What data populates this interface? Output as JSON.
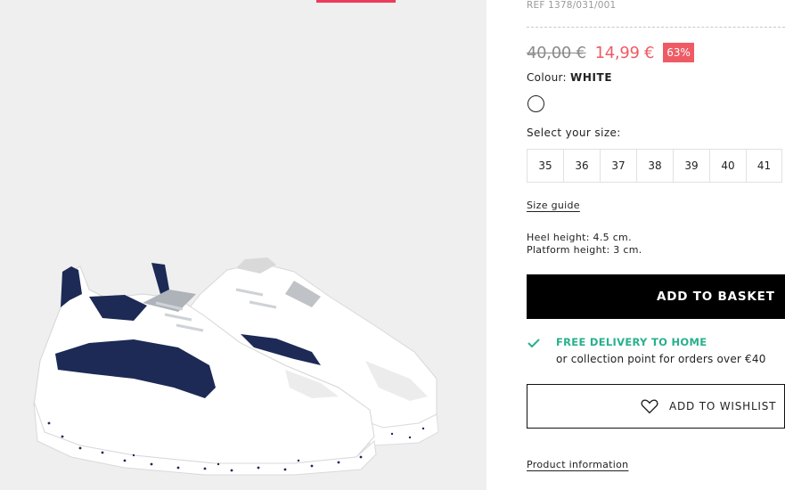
{
  "product": {
    "ref": "REF 1378/031/001",
    "old_price": "40,00 €",
    "new_price": "14,99 €",
    "discount": "63%",
    "colour_label": "Colour:",
    "colour_value": "WHITE",
    "size_label": "Select your size:",
    "sizes": [
      "35",
      "36",
      "37",
      "38",
      "39",
      "40",
      "41"
    ],
    "size_guide_label": "Size guide",
    "heel_height": "Heel height: 4.5 cm.",
    "platform_height": "Platform height: 3 cm.",
    "add_to_basket_label": "ADD TO BASKET",
    "delivery_title": "FREE DELIVERY TO HOME",
    "delivery_text": "or collection point for orders over €40",
    "wishlist_label": "ADD TO WISHLIST",
    "product_info_label": "Product information"
  },
  "colors": {
    "sale": "#ef5b64",
    "delivery": "#27b08c",
    "image_background": "#efefef",
    "navy": "#1c2a55"
  },
  "icons": {
    "delivery": "check-icon",
    "wishlist": "heart-icon",
    "colour_swatch": "white-circle"
  }
}
